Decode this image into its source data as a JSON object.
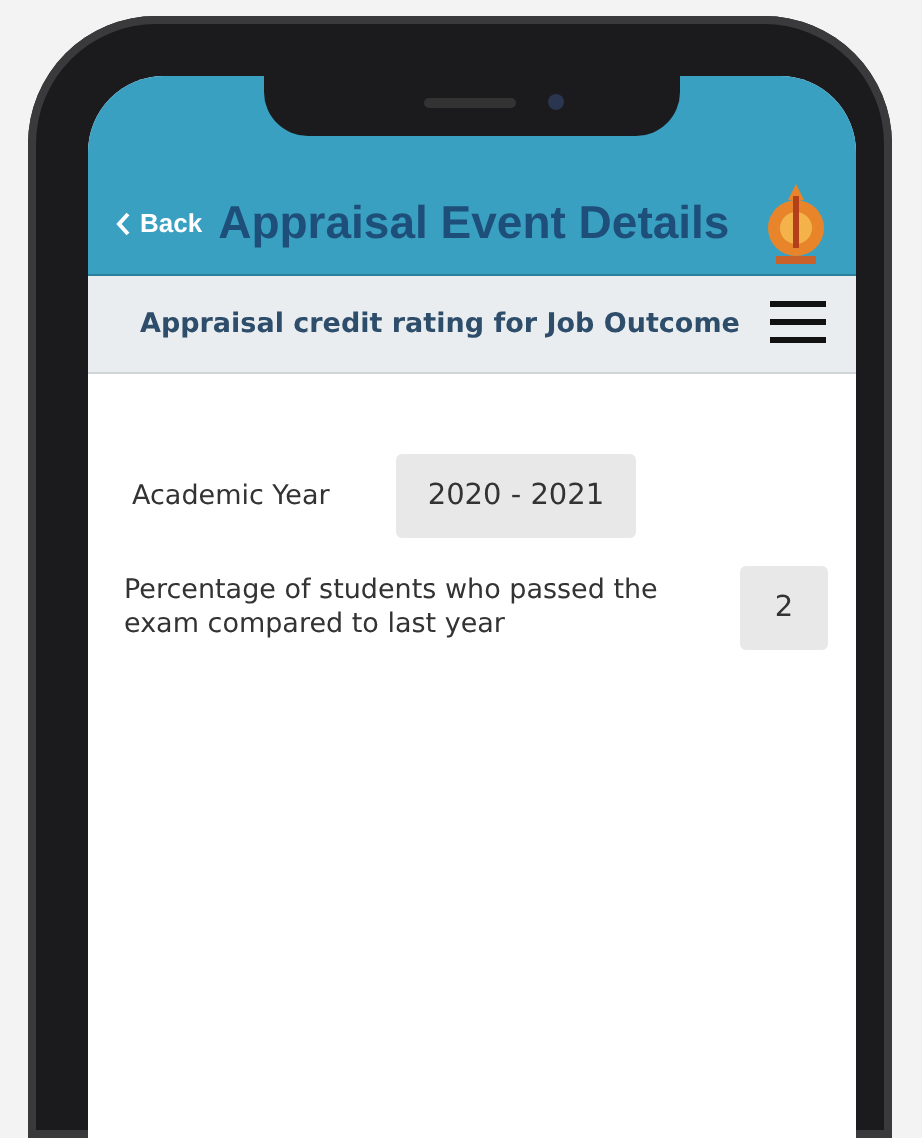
{
  "header": {
    "back_label": "Back",
    "title": "Appraisal Event Details"
  },
  "subheader": {
    "title": "Appraisal credit rating for Job Outcome"
  },
  "fields": [
    {
      "label": "Academic Year",
      "value": "2020 - 2021"
    },
    {
      "label": "Percentage of students who passed the exam compared to last year",
      "value": "2"
    }
  ]
}
